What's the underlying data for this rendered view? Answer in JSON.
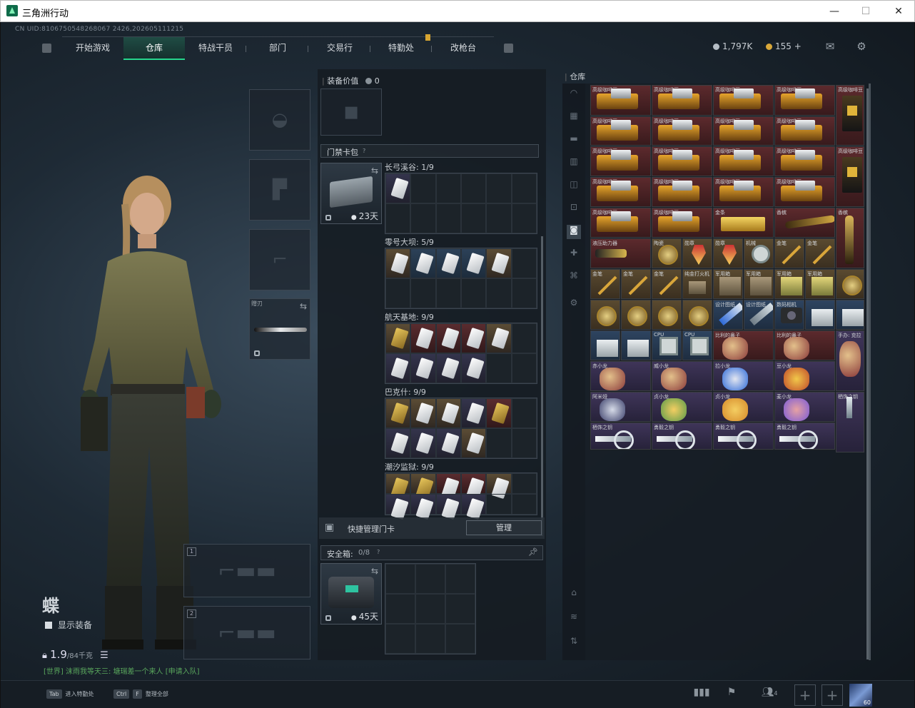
{
  "window": {
    "title": "三角洲行动",
    "min": "—",
    "max": "☐",
    "close": "✕"
  },
  "uid": "CN UID:8106750548268067 2426,202605111215",
  "nav": {
    "tabs": [
      "开始游戏",
      "仓库",
      "特战干员",
      "部门",
      "交易行",
      "特勤处",
      "改枪台"
    ],
    "active": "仓库"
  },
  "currency": {
    "silver": "1,797K",
    "gold": "155",
    "plus": "+",
    "silver_color": "#b6bec6",
    "gold_color": "#d9a83a"
  },
  "character": {
    "name": "蝶",
    "show_equipment": "显示装备",
    "weight": "1.9",
    "weight_max": "/84千克",
    "chat": "[世界] 沫雨我等天三: 塘瑞差一个来人 [申请入队]",
    "melee_label": "赠刃",
    "weapon_slot_1": "1",
    "weapon_slot_2": "2"
  },
  "middle": {
    "equip_value_label": "装备价值",
    "equip_value": "0",
    "keycard_bag": "门禁卡包",
    "help": "?",
    "keycard_days": "23天",
    "maps": [
      {
        "name": "长弓溪谷: 1/9"
      },
      {
        "name": "零号大坝: 5/9"
      },
      {
        "name": "航天基地: 9/9"
      },
      {
        "name": "巴克什: 9/9"
      },
      {
        "name": "潮汐监狱: 9/9"
      }
    ],
    "quick_manage": "快捷管理门卡",
    "manage_btn": "管理",
    "safebox_label": "安全箱:",
    "safebox_count": "0/8",
    "safebox_days": "45天"
  },
  "warehouse": {
    "title": "仓库",
    "items": [
      "高级咖啡豆",
      "高级咖啡豆",
      "高级咖啡豆",
      "高级咖啡豆",
      "高级咖啡豆",
      "金条",
      "香槟",
      "香槟",
      "液压助力器",
      "陶瓷",
      "勋章",
      "勋章",
      "机械",
      "金笔",
      "金笔",
      "金笔",
      "金笔",
      "金笔",
      "纯金打火机",
      "军用箱",
      "军用箱",
      "军用箱",
      "设计图纸",
      "设计图纸",
      "数码相机",
      "CPU",
      "CPU",
      "比利的鼻子",
      "比利的鼻子",
      "手办: 克拉",
      "赤小龙",
      "威小龙",
      "拉小龙",
      "豆小龙",
      "阿米娅",
      "贞小龙",
      "贞小龙",
      "麦小龙",
      "栖饰之钥",
      "栖饰之钥",
      "勇毅之钥",
      "勇毅之钥",
      "勇毅之钥"
    ]
  },
  "bottom": {
    "tab_key": "Tab",
    "tab_hint": "进入特勤处",
    "ctrl_key": "Ctrl",
    "f_key": "F",
    "ctrl_hint": "整理全部",
    "party": "4",
    "level": "60"
  }
}
